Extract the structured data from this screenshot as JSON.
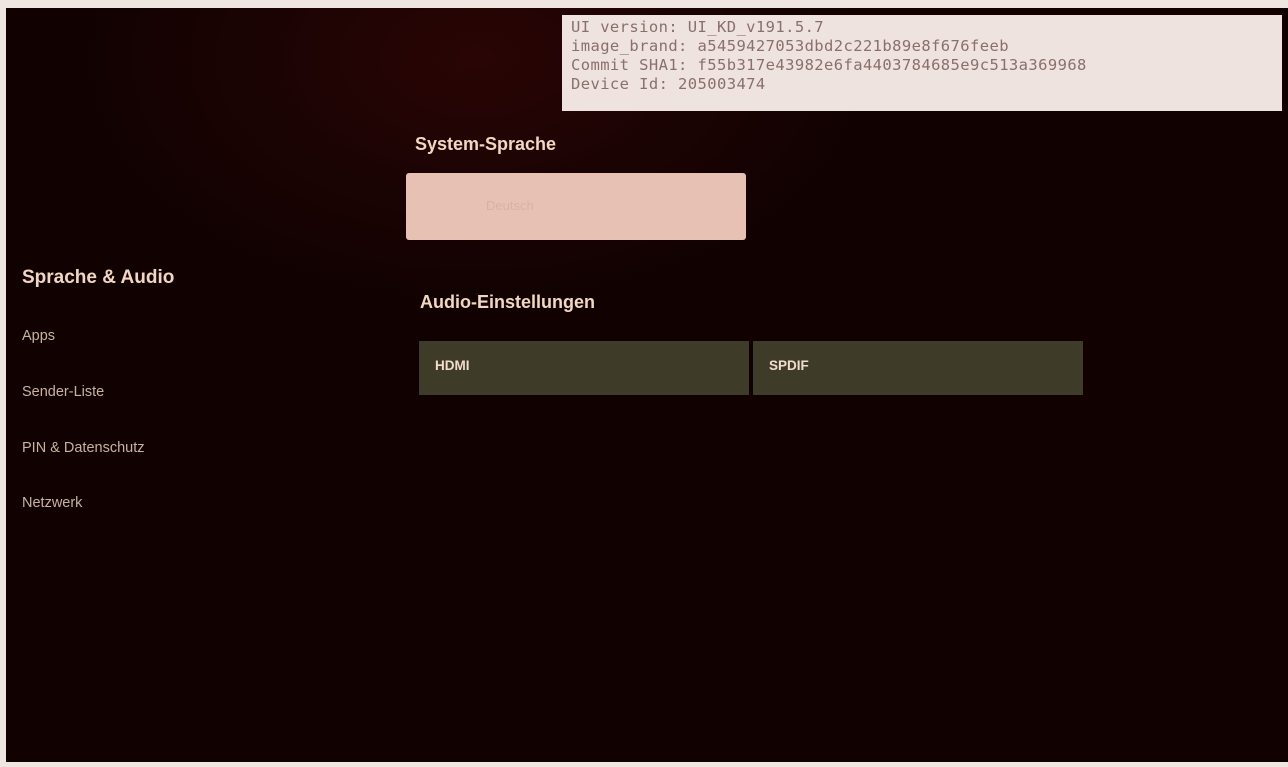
{
  "debug_info": {
    "lines": [
      "UI version: UI_KD_v191.5.7",
      "image_brand: a5459427053dbd2c221b89e8f676feeb",
      "Commit SHA1: f55b317e43982e6fa4403784685e9c513a369968",
      "Device Id: 205003474"
    ]
  },
  "sidebar": {
    "items": [
      {
        "label": "Sprache & Audio",
        "active": true
      },
      {
        "label": "Apps"
      },
      {
        "label": "Sender-Liste"
      },
      {
        "label": "PIN & Datenschutz"
      },
      {
        "label": "Netzwerk"
      }
    ]
  },
  "main": {
    "system_language": {
      "title": "System-Sprache",
      "value": "Deutsch"
    },
    "audio": {
      "title": "Audio-Einstellungen",
      "buttons": [
        {
          "label": "HDMI"
        },
        {
          "label": "SPDIF"
        }
      ]
    }
  }
}
